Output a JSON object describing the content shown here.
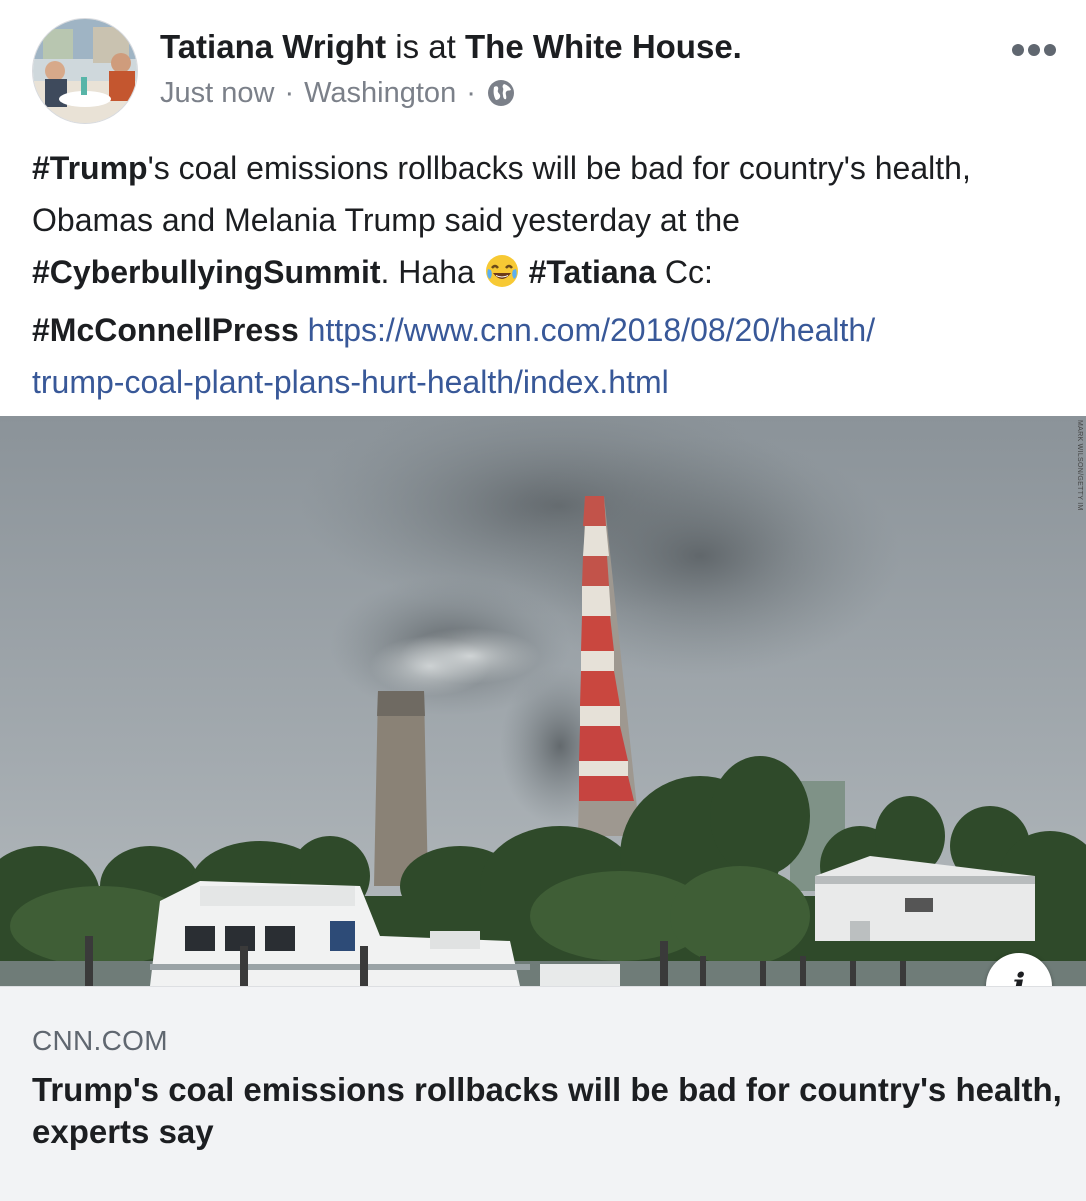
{
  "post": {
    "author": "Tatiana Wright",
    "is_at": "is at",
    "place": "The White House.",
    "time": "Just now",
    "location": "Washington",
    "separator": "·",
    "privacy_icon": "globe-icon",
    "more_icon": "more-options-icon",
    "text": {
      "tag1": "#Trump",
      "part1": "'s coal emissions rollbacks will be bad for country's health, Obamas and Melania Trump said yesterday at the ",
      "tag2": "#CyberbullyingSummit",
      "part2": ". Haha ",
      "emoji": "tears-of-joy-emoji",
      "tag3": "#Tatiana",
      "part3": " Cc: ",
      "tag4": "#McConnellPress",
      "link_line1": "https://www.cnn.com/2018/08/20/health/",
      "link_line2": "trump-coal-plant-plans-hurt-health/index.html"
    }
  },
  "link_card": {
    "image_credit": "MARK WILSON/GETTY IM",
    "info_icon": "info-icon",
    "info_label": "i",
    "domain": "CNN.COM",
    "title": "Trump's coal emissions rollbacks will be bad for country's health, experts say"
  },
  "colors": {
    "link": "#385898",
    "meta": "#7b8089",
    "card_bg": "#f2f3f5"
  }
}
